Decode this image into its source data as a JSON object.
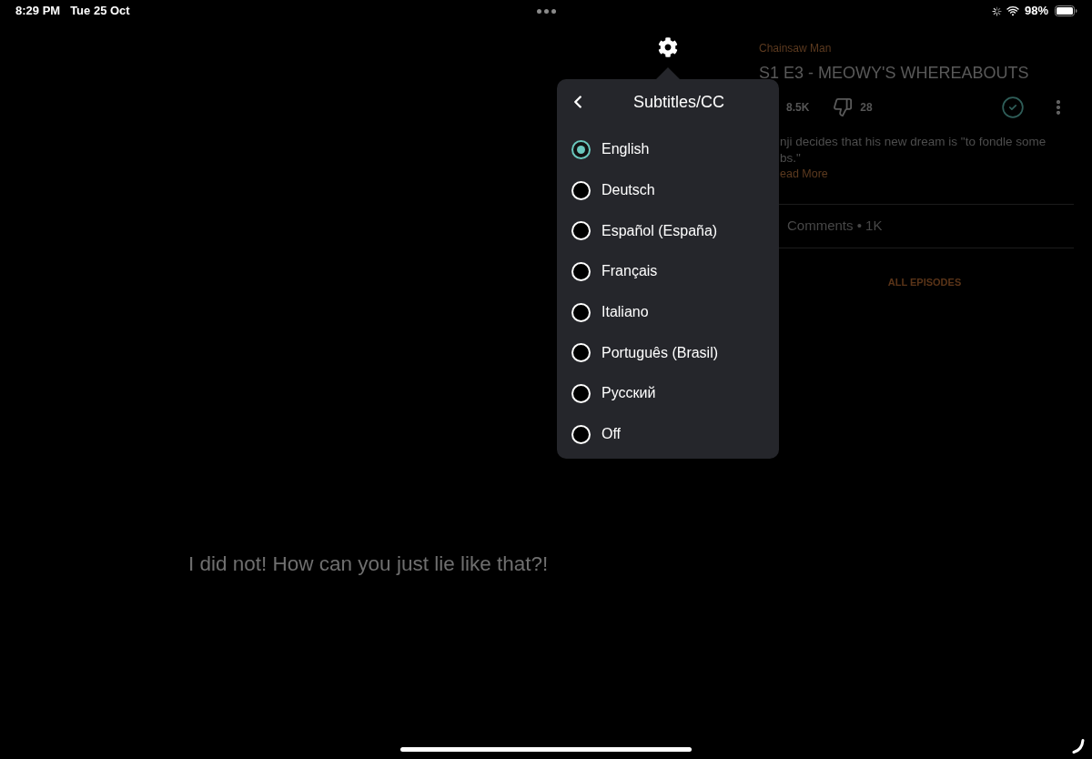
{
  "status_bar": {
    "time": "8:29 PM",
    "date": "Tue 25 Oct",
    "battery": "98%"
  },
  "episode": {
    "series": "Chainsaw Man",
    "title": "S1 E3 - MEOWY'S WHEREABOUTS",
    "likes": "8.5K",
    "dislikes": "28",
    "description_lines": [
      "nji decides that his new dream is \"to fondle some",
      "bs.\""
    ],
    "read_more": "ead More",
    "comments": "Comments • 1K",
    "all_episodes": "ALL EPISODES"
  },
  "subtitle_menu": {
    "title": "Subtitles/CC",
    "options": [
      {
        "label": "English",
        "selected": true
      },
      {
        "label": "Deutsch",
        "selected": false
      },
      {
        "label": "Español (España)",
        "selected": false
      },
      {
        "label": "Français",
        "selected": false
      },
      {
        "label": "Italiano",
        "selected": false
      },
      {
        "label": "Português (Brasil)",
        "selected": false
      },
      {
        "label": "Русский",
        "selected": false
      },
      {
        "label": "Off",
        "selected": false
      }
    ]
  },
  "caption": "I did not! How can you just lie like that?!"
}
